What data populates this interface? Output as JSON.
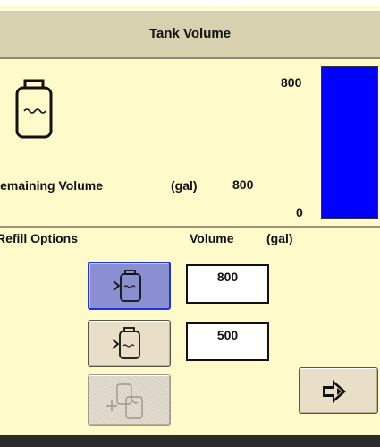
{
  "header": {
    "title": "Tank Volume"
  },
  "tank": {
    "icon": "tank-level-icon",
    "remaining_label": "Remaining Volume",
    "unit_label": "(gal)",
    "remaining_value": "800",
    "gauge": {
      "max_label": "800",
      "min_label": "0",
      "fill_fraction": 1.0,
      "fill_color": "#0000ff"
    }
  },
  "refill": {
    "options_label": "Refill Options",
    "volume_label": "Volume",
    "volume_unit": "(gal)",
    "options": [
      {
        "icon": "refill-full-tank-icon",
        "selected": true,
        "value": "800"
      },
      {
        "icon": "refill-partial-tank-icon",
        "selected": false,
        "value": "500"
      },
      {
        "icon": "transfer-tank-icon",
        "disabled": true
      }
    ]
  },
  "actions": {
    "next_icon": "arrow-right-icon"
  },
  "colors": {
    "background": "#fffac9",
    "titlebar": "#d8d1b0",
    "selected_button": "#8a8fd2",
    "selected_border": "#1d33d8",
    "gauge_fill": "#0000ff"
  }
}
